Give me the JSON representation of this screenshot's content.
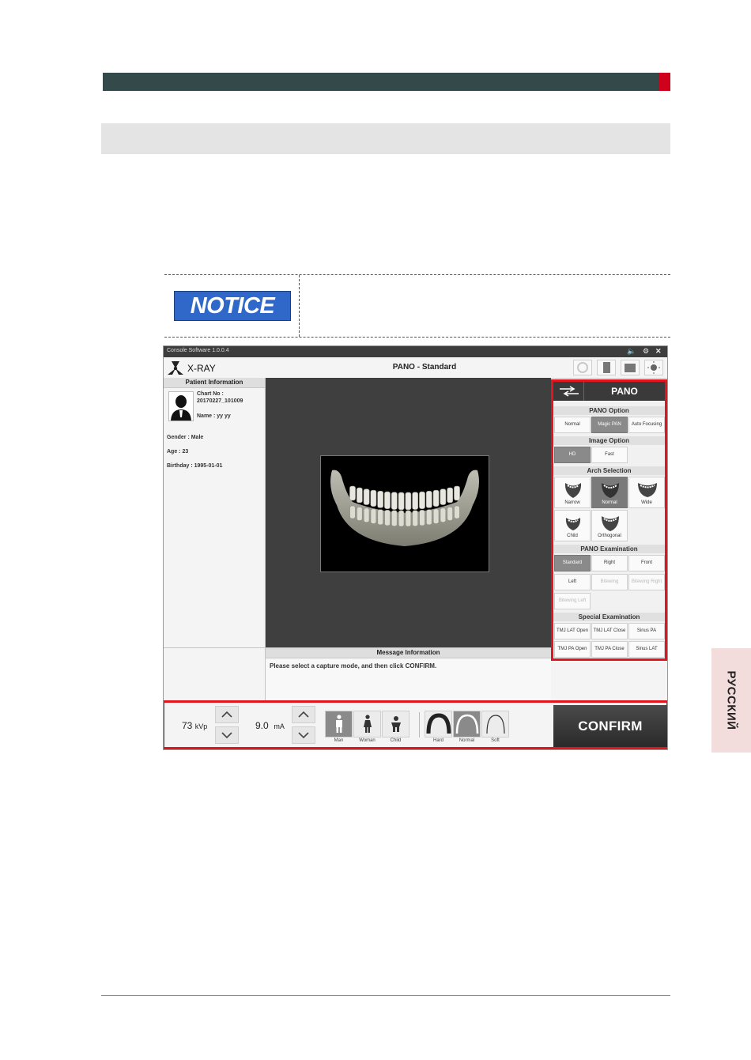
{
  "notice": {
    "label": "NOTICE"
  },
  "side_tab": {
    "language": "РУССКИЙ"
  },
  "app": {
    "window_title": "Console Software  1.0.0.4",
    "app_name": "X-RAY",
    "mode_title": "PANO - Standard",
    "patient": {
      "header": "Patient Information",
      "chart_no_label": "Chart No :",
      "chart_no": "20170227_101009",
      "name": "Name : yy yy",
      "gender": "Gender : Male",
      "age": "Age : 23",
      "birthday": "Birthday : 1995-01-01"
    },
    "options": {
      "mode": "PANO",
      "pano_option": {
        "title": "PANO Option",
        "items": [
          "Normal",
          "Magic PAN",
          "Auto Focusing"
        ],
        "selected": "Magic PAN"
      },
      "image_option": {
        "title": "Image Option",
        "items": [
          "HD",
          "Fast"
        ],
        "selected": "HD"
      },
      "arch_selection": {
        "title": "Arch Selection",
        "items": [
          "Narrow",
          "Normal",
          "Wide",
          "Child",
          "Orthogonal"
        ],
        "selected": "Normal"
      },
      "pano_examination": {
        "title": "PANO Examination",
        "items": [
          "Standard",
          "Right",
          "Front",
          "Left",
          "Bitewing",
          "Bitewing Right",
          "Bitewing Left"
        ],
        "selected": "Standard"
      },
      "special_examination": {
        "title": "Special Examination",
        "items": [
          "TMJ LAT Open",
          "TMJ LAT Close",
          "Sinus PA",
          "TMJ PA Open",
          "TMJ PA Close",
          "Sinus LAT"
        ]
      }
    },
    "message": {
      "header": "Message Information",
      "text": "Please select a capture mode, and then click CONFIRM."
    },
    "controls": {
      "kvp_value": "73",
      "kvp_unit": "kVp",
      "ma_value": "9.0",
      "ma_unit": "mA",
      "patient_types": [
        "Man",
        "Woman",
        "Child"
      ],
      "patient_selected": "Man",
      "density": [
        "Hard",
        "Normal",
        "Soft"
      ],
      "density_selected": "Normal",
      "confirm_label": "CONFIRM"
    }
  },
  "colors": {
    "header_bar": "#34494a",
    "accent_red": "#e3141b",
    "notice_blue": "#2f68c8",
    "side_tab": "#f3dcdc"
  }
}
